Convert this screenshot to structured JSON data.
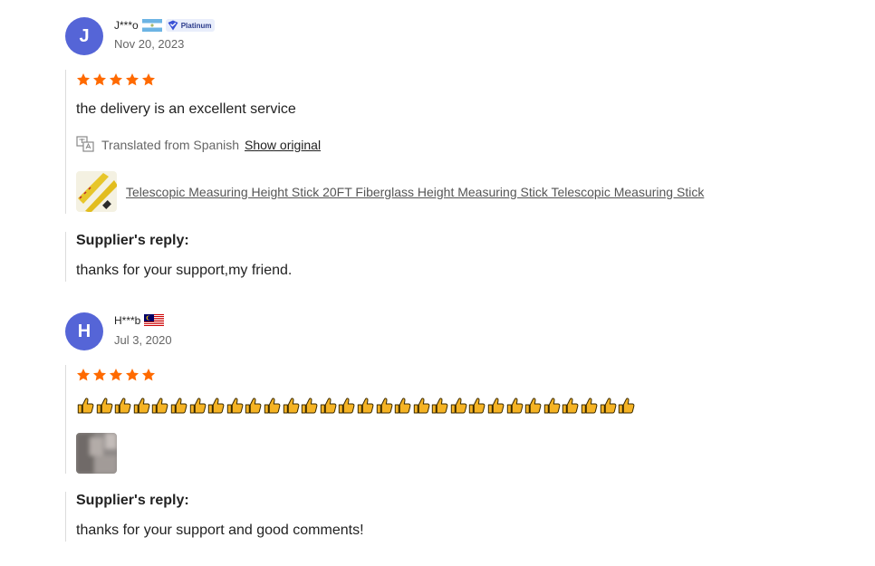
{
  "reviews": [
    {
      "initial": "J",
      "name": "J***o",
      "badge": "Platinum",
      "date": "Nov 20, 2023",
      "rating": 5,
      "text": "the delivery is an excellent service",
      "translation": {
        "note": "Translated from Spanish",
        "link": "Show original"
      },
      "product": "Telescopic Measuring Height Stick 20FT Fiberglass Height Measuring Stick Telescopic Measuring Stick",
      "reply_title": "Supplier's reply:",
      "reply_text": "thanks for your support,my friend."
    },
    {
      "initial": "H",
      "name": "H***b",
      "date": "Jul 3, 2020",
      "rating": 5,
      "thumbs_up_count": 30,
      "reply_title": "Supplier's reply:",
      "reply_text": "thanks for your support and good comments!"
    }
  ],
  "colors": {
    "avatar": "#5565d7",
    "star": "#ff6a00",
    "thumb": "#f5b324"
  },
  "icons": [
    "star-icon",
    "translate-icon",
    "verified-badge-icon",
    "thumbs-up-icon",
    "flag-icon"
  ]
}
